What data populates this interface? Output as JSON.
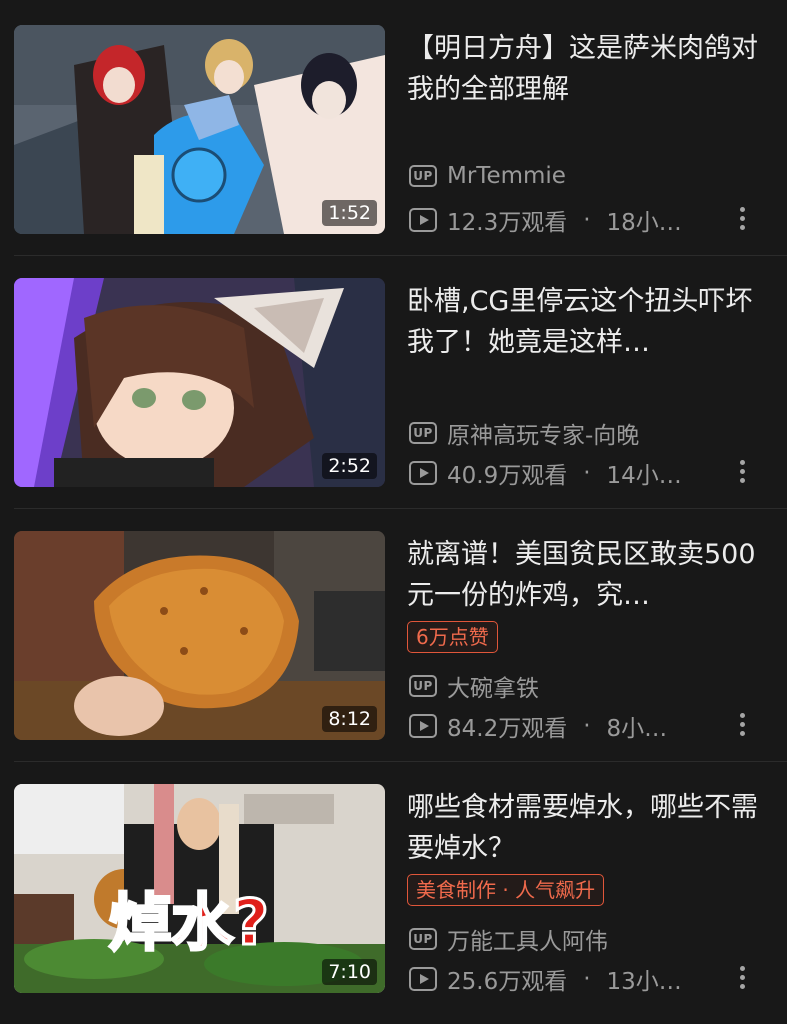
{
  "videos": [
    {
      "title": "【明日方舟】这是萨米肉鸽对我的全部理解",
      "duration": "1:52",
      "uploader": "MrTemmie",
      "views": "12.3万观看",
      "time": "18小…",
      "badge": ""
    },
    {
      "title": "卧槽,CG里停云这个扭头吓坏我了！她竟是这样…",
      "duration": "2:52",
      "uploader": "原神高玩专家-向晚",
      "views": "40.9万观看",
      "time": "14小…",
      "badge": ""
    },
    {
      "title": "就离谱！美国贫民区敢卖500元一份的炸鸡，究…",
      "duration": "8:12",
      "uploader": "大碗拿铁",
      "views": "84.2万观看",
      "time": "8小…",
      "badge": "6万点赞"
    },
    {
      "title": "哪些食材需要焯水，哪些不需要焯水？",
      "duration": "7:10",
      "uploader": "万能工具人阿伟",
      "views": "25.6万观看",
      "time": "13小…",
      "badge": "美食制作 · 人气飙升",
      "thumb_text": "焯水?"
    }
  ],
  "labels": {
    "up": "UP",
    "separator": "·"
  },
  "colors": {
    "background": "#181818",
    "badge": "#e0563a",
    "meta": "#9a9a9a"
  },
  "icons": [
    "up-icon",
    "play-icon",
    "more-vertical-icon"
  ]
}
